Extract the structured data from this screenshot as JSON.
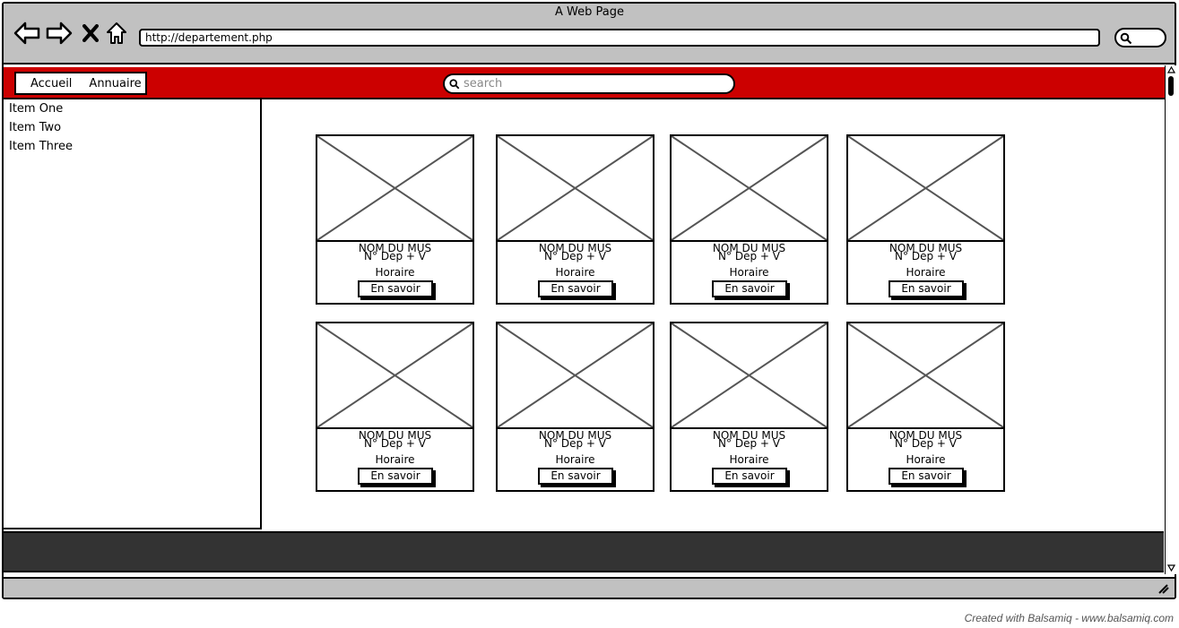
{
  "browser": {
    "title": "A Web Page",
    "url": "http://departement.php"
  },
  "nav": {
    "links": [
      "Accueil",
      "Annuaire"
    ]
  },
  "search": {
    "placeholder": "search"
  },
  "sidebar": {
    "items": [
      "Item One",
      "Item Two",
      "Item Three"
    ]
  },
  "cards": [
    {
      "name": "NOM DU MUS",
      "dep": "N° Dep + V",
      "hours": "Horaire",
      "button": "En savoir"
    },
    {
      "name": "NOM DU MUS",
      "dep": "N° Dep + V",
      "hours": "Horaire",
      "button": "En savoir"
    },
    {
      "name": "NOM DU MUS",
      "dep": "N° Dep + V",
      "hours": "Horaire",
      "button": "En savoir"
    },
    {
      "name": "NOM DU MUS",
      "dep": "N° Dep + V",
      "hours": "Horaire",
      "button": "En savoir"
    },
    {
      "name": "NOM DU MUS",
      "dep": "N° Dep + V",
      "hours": "Horaire",
      "button": "En savoir"
    },
    {
      "name": "NOM DU MUS",
      "dep": "N° Dep + V",
      "hours": "Horaire",
      "button": "En savoir"
    },
    {
      "name": "NOM DU MUS",
      "dep": "N° Dep + V",
      "hours": "Horaire",
      "button": "En savoir"
    },
    {
      "name": "NOM DU MUS",
      "dep": "N° Dep + V",
      "hours": "Horaire",
      "button": "En savoir"
    }
  ],
  "credit": "Created with Balsamiq - www.balsamiq.com",
  "colors": {
    "header": "#cc0000",
    "footer": "#333333",
    "chrome": "#c1c1c1"
  }
}
